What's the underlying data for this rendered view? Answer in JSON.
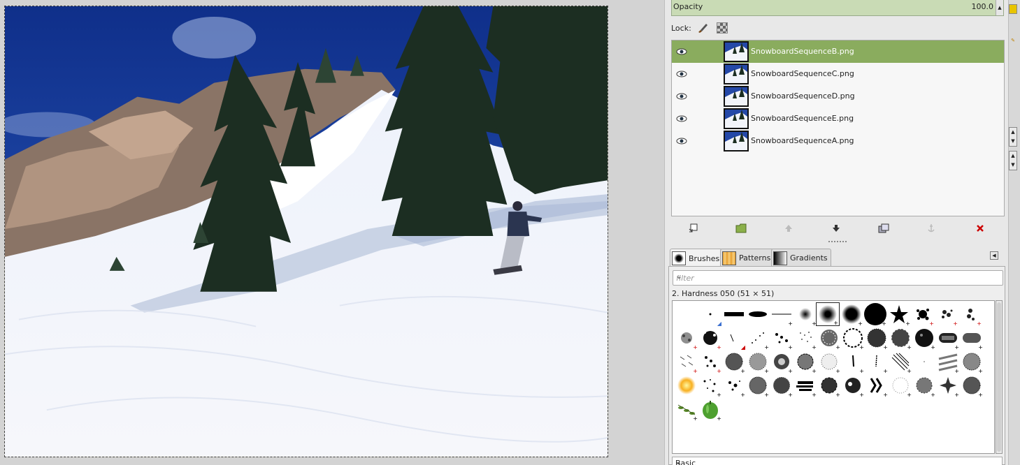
{
  "layers_panel": {
    "opacity_label": "Opacity",
    "opacity_value": "100.0",
    "lock_label": "Lock:",
    "layers": [
      {
        "name": "SnowboardSequenceB.png",
        "selected": true
      },
      {
        "name": "SnowboardSequenceC.png",
        "selected": false
      },
      {
        "name": "SnowboardSequenceD.png",
        "selected": false
      },
      {
        "name": "SnowboardSequenceE.png",
        "selected": false
      },
      {
        "name": "SnowboardSequenceA.png",
        "selected": false
      }
    ],
    "buttons": [
      "new-layer-icon",
      "new-layer-group-icon",
      "raise-layer-icon",
      "lower-layer-icon",
      "duplicate-layer-icon",
      "anchor-layer-icon",
      "delete-layer-icon"
    ]
  },
  "tabs": [
    {
      "label": "Brushes"
    },
    {
      "label": "Patterns"
    },
    {
      "label": "Gradients"
    }
  ],
  "brushes": {
    "filter_placeholder": "filter",
    "selected_brush": "2. Hardness 050 (51 × 51)",
    "preset": "Basic"
  },
  "colors": {
    "selected_layer": "#8aac5e",
    "opacity_bg": "#c9dbb5",
    "delete_icon": "#cc0000"
  }
}
